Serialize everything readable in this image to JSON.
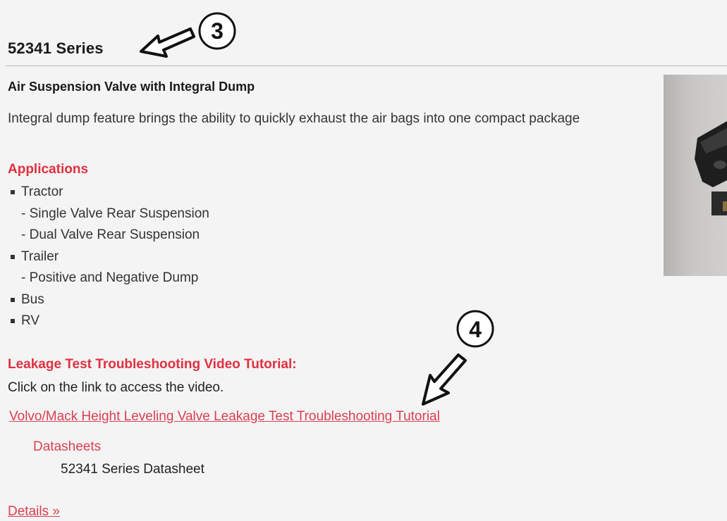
{
  "product": {
    "title": "52341 Series",
    "subtitle": "Air Suspension Valve with Integral Dump",
    "description": "Integral dump feature brings the ability to quickly exhaust the air bags into one compact package"
  },
  "applications": {
    "heading": "Applications",
    "items": [
      {
        "label": "Tractor",
        "sub": [
          "- Single Valve Rear Suspension",
          "- Dual Valve Rear Suspension"
        ]
      },
      {
        "label": "Trailer",
        "sub": [
          "- Positive and Negative Dump"
        ]
      },
      {
        "label": "Bus",
        "sub": []
      },
      {
        "label": "RV",
        "sub": []
      }
    ]
  },
  "video": {
    "heading": "Leakage Test Troubleshooting Video Tutorial:",
    "note": "Click on the link to access the video.",
    "link_label": "Volvo/Mack Height Leveling Valve Leakage Test Troubleshooting Tutorial"
  },
  "datasheets": {
    "label": "Datasheets",
    "item": "52341 Series Datasheet"
  },
  "details": {
    "label": "Details »"
  },
  "callouts": {
    "first": "3",
    "second": "4"
  },
  "colors": {
    "accent_red": "#e03040",
    "link_red": "#d84050",
    "background": "#f4f4f4",
    "text": "#222222"
  }
}
